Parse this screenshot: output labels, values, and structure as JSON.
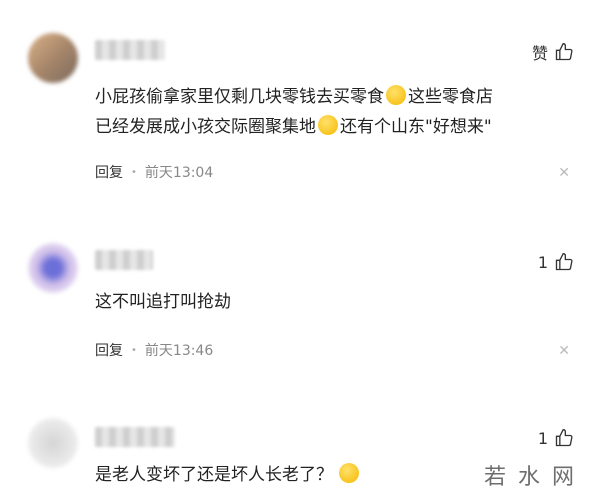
{
  "comments": [
    {
      "likes": "赞",
      "text_line1_a": "小屁孩偷拿家里仅剩几块零钱去买零食",
      "text_line1_b": "这些零食店",
      "text_line2_a": "已经发展成小孩交际圈聚集地",
      "text_line2_b": "还有个山东\"好想来\"",
      "reply": "回复",
      "time": "前天13:04"
    },
    {
      "likes": "1",
      "text": "这不叫追打叫抢劫",
      "reply": "回复",
      "time": "前天13:46"
    },
    {
      "likes": "1",
      "text": "是老人变坏了还是坏人长老了？",
      "reply": "",
      "time": ""
    }
  ],
  "watermark": "若水网",
  "colors": {
    "meta": "#888888",
    "text": "#222222",
    "emoji": "#f5b800"
  }
}
